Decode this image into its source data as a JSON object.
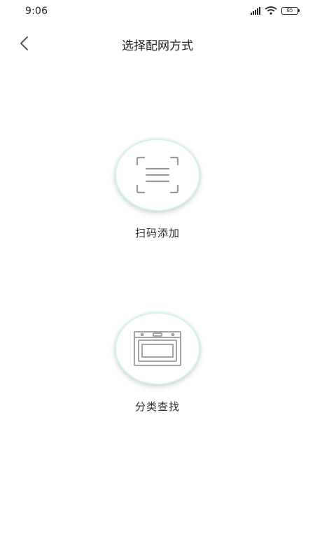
{
  "status_bar": {
    "time": "9:06",
    "battery": "85",
    "icons": [
      "signal-icon",
      "wifi-icon",
      "battery-icon"
    ]
  },
  "header": {
    "back_icon": "chevron-left-icon",
    "title": "选择配网方式"
  },
  "options": [
    {
      "id": "scan",
      "icon": "qr-scan-icon",
      "label": "扫码添加"
    },
    {
      "id": "category",
      "icon": "oven-icon",
      "label": "分类查找"
    }
  ],
  "colors": {
    "background": "#ffffff",
    "circle_border": "#d6f1f1",
    "icon_stroke": "#9a9a9a",
    "text": "#333333"
  }
}
